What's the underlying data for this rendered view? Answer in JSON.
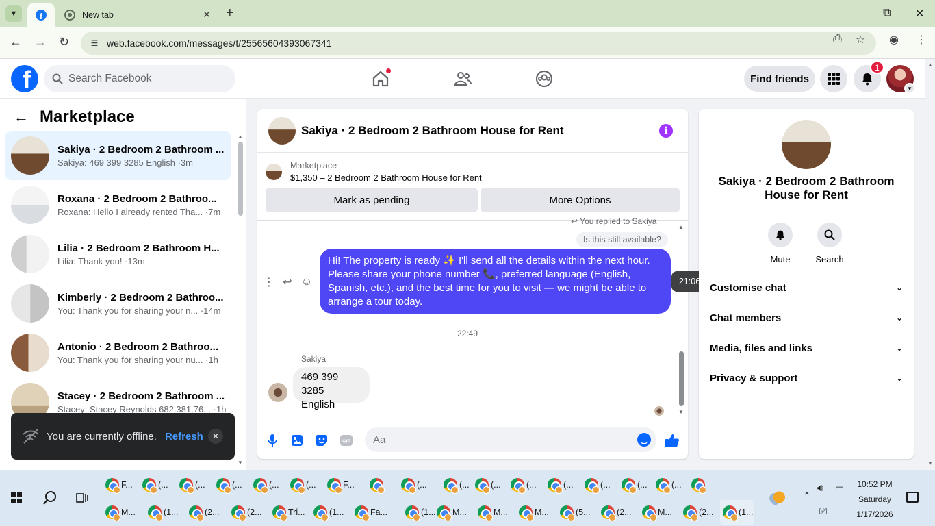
{
  "browser": {
    "tabs": [
      {
        "label": ""
      },
      {
        "label": "New tab"
      }
    ],
    "url": "web.facebook.com/messages/t/25565604393067341"
  },
  "fb_header": {
    "search_placeholder": "Search Facebook",
    "find_friends": "Find friends",
    "notification_count": "1"
  },
  "left_pane": {
    "title": "Marketplace",
    "conversations": [
      {
        "name": "Sakiya · 2 Bedroom 2 Bathroom ...",
        "preview": "Sakiya: 469 399 3285 English ·3m"
      },
      {
        "name": "Roxana · 2 Bedroom 2 Bathroo...",
        "preview": "Roxana: Hello I already rented Tha... ·7m"
      },
      {
        "name": "Lilia · 2 Bedroom 2 Bathroom H...",
        "preview": "Lilia: Thank you! ·13m"
      },
      {
        "name": "Kimberly · 2 Bedroom 2 Bathroo...",
        "preview": "You: Thank you for sharing your n... ·14m"
      },
      {
        "name": "Antonio · 2 Bedroom 2 Bathroo...",
        "preview": "You: Thank you for sharing your nu... ·1h"
      },
      {
        "name": "Stacey · 2 Bedroom 2 Bathroom ...",
        "preview": "Stacey: Stacey Reynolds 682.381.76... ·1h"
      }
    ]
  },
  "toast": {
    "message": "You are currently offline.",
    "action": "Refresh"
  },
  "chat": {
    "title": "Sakiya · 2 Bedroom 2 Bathroom House for Rent",
    "marketplace_label": "Marketplace",
    "listing": "$1,350 – 2 Bedroom 2 Bathroom House for Rent",
    "mark_pending": "Mark as pending",
    "more_options": "More Options",
    "replied_note": "You replied to Sakiya",
    "quoted": "Is this still available?",
    "my_message": "Hi! The property is ready ✨ I'll send all the details within the next hour. Please share your phone number 📞, preferred language (English, Spanish, etc.), and the best time for you to visit — we might be able to arrange a tour today.",
    "time_tooltip": "21:06",
    "timestamp": "22:49",
    "sender_name": "Sakiya",
    "their_message_line1": "469 399 3285",
    "their_message_line2": "English",
    "composer_placeholder": "Aa"
  },
  "right_pane": {
    "title": "Sakiya · 2 Bedroom 2 Bathroom House for Rent",
    "mute": "Mute",
    "search": "Search",
    "sections": [
      "Customise chat",
      "Chat members",
      "Media, files and links",
      "Privacy & support"
    ]
  },
  "taskbar": {
    "row1": [
      "F...",
      "(...",
      "(...",
      "(...",
      "(...",
      "(...",
      "F...",
      "",
      "(...",
      "(...",
      "(...",
      "(...",
      "(...",
      "(...",
      "(...",
      "(...",
      ""
    ],
    "row2": [
      "M...",
      "(1...",
      "(2...",
      "(2...",
      "Tri...",
      "(1...",
      "Fa...",
      "(1...",
      "M...",
      "M...",
      "M...",
      "(5...",
      "(2...",
      "M...",
      "(2...",
      "(1..."
    ],
    "time": "10:52 PM",
    "day": "Saturday",
    "date": "1/17/2026"
  },
  "colors": {
    "fb_blue": "#0866ff",
    "my_bubble": "#4f46f5",
    "active_row": "#e7f3ff"
  }
}
